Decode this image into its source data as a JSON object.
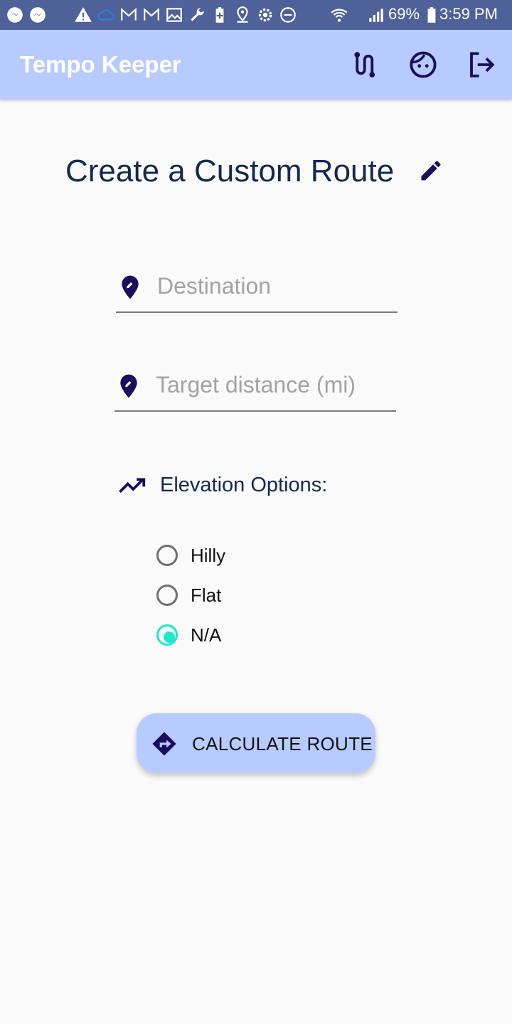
{
  "status_bar": {
    "battery": "69%",
    "time": "3:59 PM",
    "icons": [
      "messenger-icon",
      "messenger-icon",
      "warning-icon",
      "cloud-icon",
      "gmail-icon",
      "gmail-icon",
      "photo-icon",
      "wrench-icon",
      "battery-saver-icon",
      "location-icon",
      "settings-icon",
      "do-not-disturb-icon",
      "wifi-icon",
      "signal-icon",
      "battery-icon"
    ]
  },
  "app_bar": {
    "title": "Tempo Keeper",
    "actions": [
      "route-icon",
      "face-icon",
      "logout-icon"
    ]
  },
  "page": {
    "title": "Create a Custom Route"
  },
  "form": {
    "destination": {
      "value": "",
      "placeholder": "Destination"
    },
    "target_distance": {
      "value": "",
      "placeholder": "Target distance (mi)"
    },
    "elevation": {
      "label": "Elevation Options:",
      "options": [
        {
          "label": "Hilly",
          "checked": false
        },
        {
          "label": "Flat",
          "checked": false
        },
        {
          "label": "N/A",
          "checked": true
        }
      ]
    },
    "submit_label": "CALCULATE ROUTE"
  },
  "colors": {
    "status_bar": "#4e6199",
    "app_bar": "#b8cbff",
    "primary_dark": "#14294f",
    "icon_color": "#1a0e5c",
    "radio_checked": "#1de9c9",
    "button": "#b8cbff"
  }
}
